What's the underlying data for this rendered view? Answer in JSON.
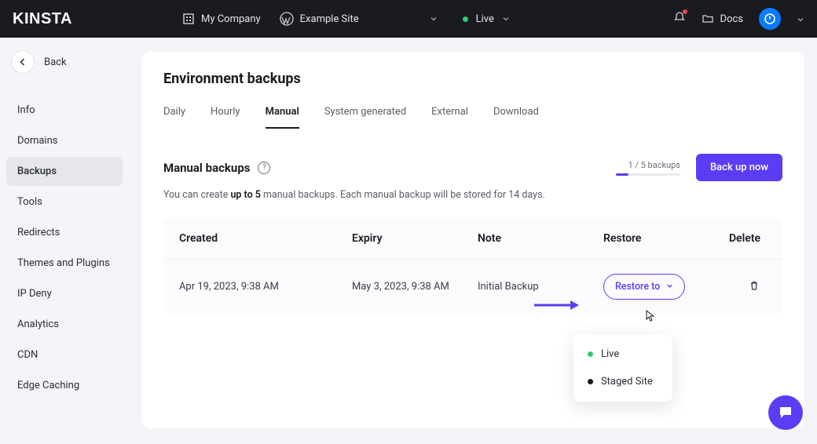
{
  "topbar": {
    "logo": "KINSTA",
    "company": "My Company",
    "site": "Example Site",
    "env": "Live",
    "docs": "Docs"
  },
  "sidebar": {
    "back": "Back",
    "items": [
      "Info",
      "Domains",
      "Backups",
      "Tools",
      "Redirects",
      "Themes and Plugins",
      "IP Deny",
      "Analytics",
      "CDN",
      "Edge Caching"
    ],
    "active_index": 2
  },
  "page": {
    "title": "Environment backups",
    "tabs": [
      "Daily",
      "Hourly",
      "Manual",
      "System generated",
      "External",
      "Download"
    ],
    "active_tab": 2
  },
  "manual": {
    "heading": "Manual backups",
    "progress_label": "1 / 5 backups",
    "backup_now": "Back up now",
    "desc_pre": "You can create ",
    "desc_bold": "up to 5",
    "desc_post": " manual backups. Each manual backup will be stored for 14 days."
  },
  "table": {
    "headers": {
      "created": "Created",
      "expiry": "Expiry",
      "note": "Note",
      "restore": "Restore",
      "delete": "Delete"
    },
    "rows": [
      {
        "created": "Apr 19, 2023, 9:38 AM",
        "expiry": "May 3, 2023, 9:38 AM",
        "note": "Initial Backup",
        "restore_label": "Restore to"
      }
    ]
  },
  "dropdown": {
    "options": [
      {
        "label": "Live",
        "color": "green"
      },
      {
        "label": "Staged Site",
        "color": "black"
      }
    ]
  }
}
